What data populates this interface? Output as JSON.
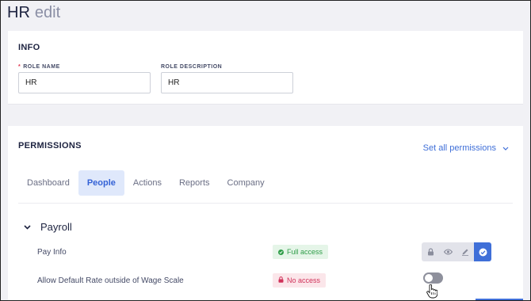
{
  "page": {
    "title": "HR",
    "title_suffix": "edit"
  },
  "info": {
    "section_title": "INFO",
    "required_marker": "*",
    "role_name_label": "ROLE NAME",
    "role_name_value": "HR",
    "role_description_label": "ROLE DESCRIPTION",
    "role_description_value": "HR"
  },
  "permissions": {
    "section_title": "PERMISSIONS",
    "set_all_label": "Set all permissions",
    "tabs": [
      {
        "label": "Dashboard",
        "active": false
      },
      {
        "label": "People",
        "active": true
      },
      {
        "label": "Actions",
        "active": false
      },
      {
        "label": "Reports",
        "active": false
      },
      {
        "label": "Company",
        "active": false
      }
    ],
    "group": {
      "label": "Payroll",
      "expanded": true
    },
    "rows": [
      {
        "label": "Pay Info",
        "badge": "Full access",
        "badge_type": "full",
        "control": "permission-levels",
        "selected_level": "full"
      },
      {
        "label": "Allow Default Rate outside of Wage Scale",
        "badge": "No access",
        "badge_type": "none",
        "control": "toggle",
        "toggle_on": false
      }
    ]
  },
  "icons": {
    "group_caret": "chevron-down-icon",
    "set_all_chevron": "chevron-down-icon",
    "permission_levels": [
      "lock-icon",
      "eye-icon",
      "pencil-icon",
      "check-circle-icon"
    ],
    "cursor": "hand-pointer-icon"
  },
  "colors": {
    "accent": "#3f6fd8",
    "full_access": "#2f9d48",
    "no_access": "#d0325a",
    "required": "#e0334c"
  }
}
